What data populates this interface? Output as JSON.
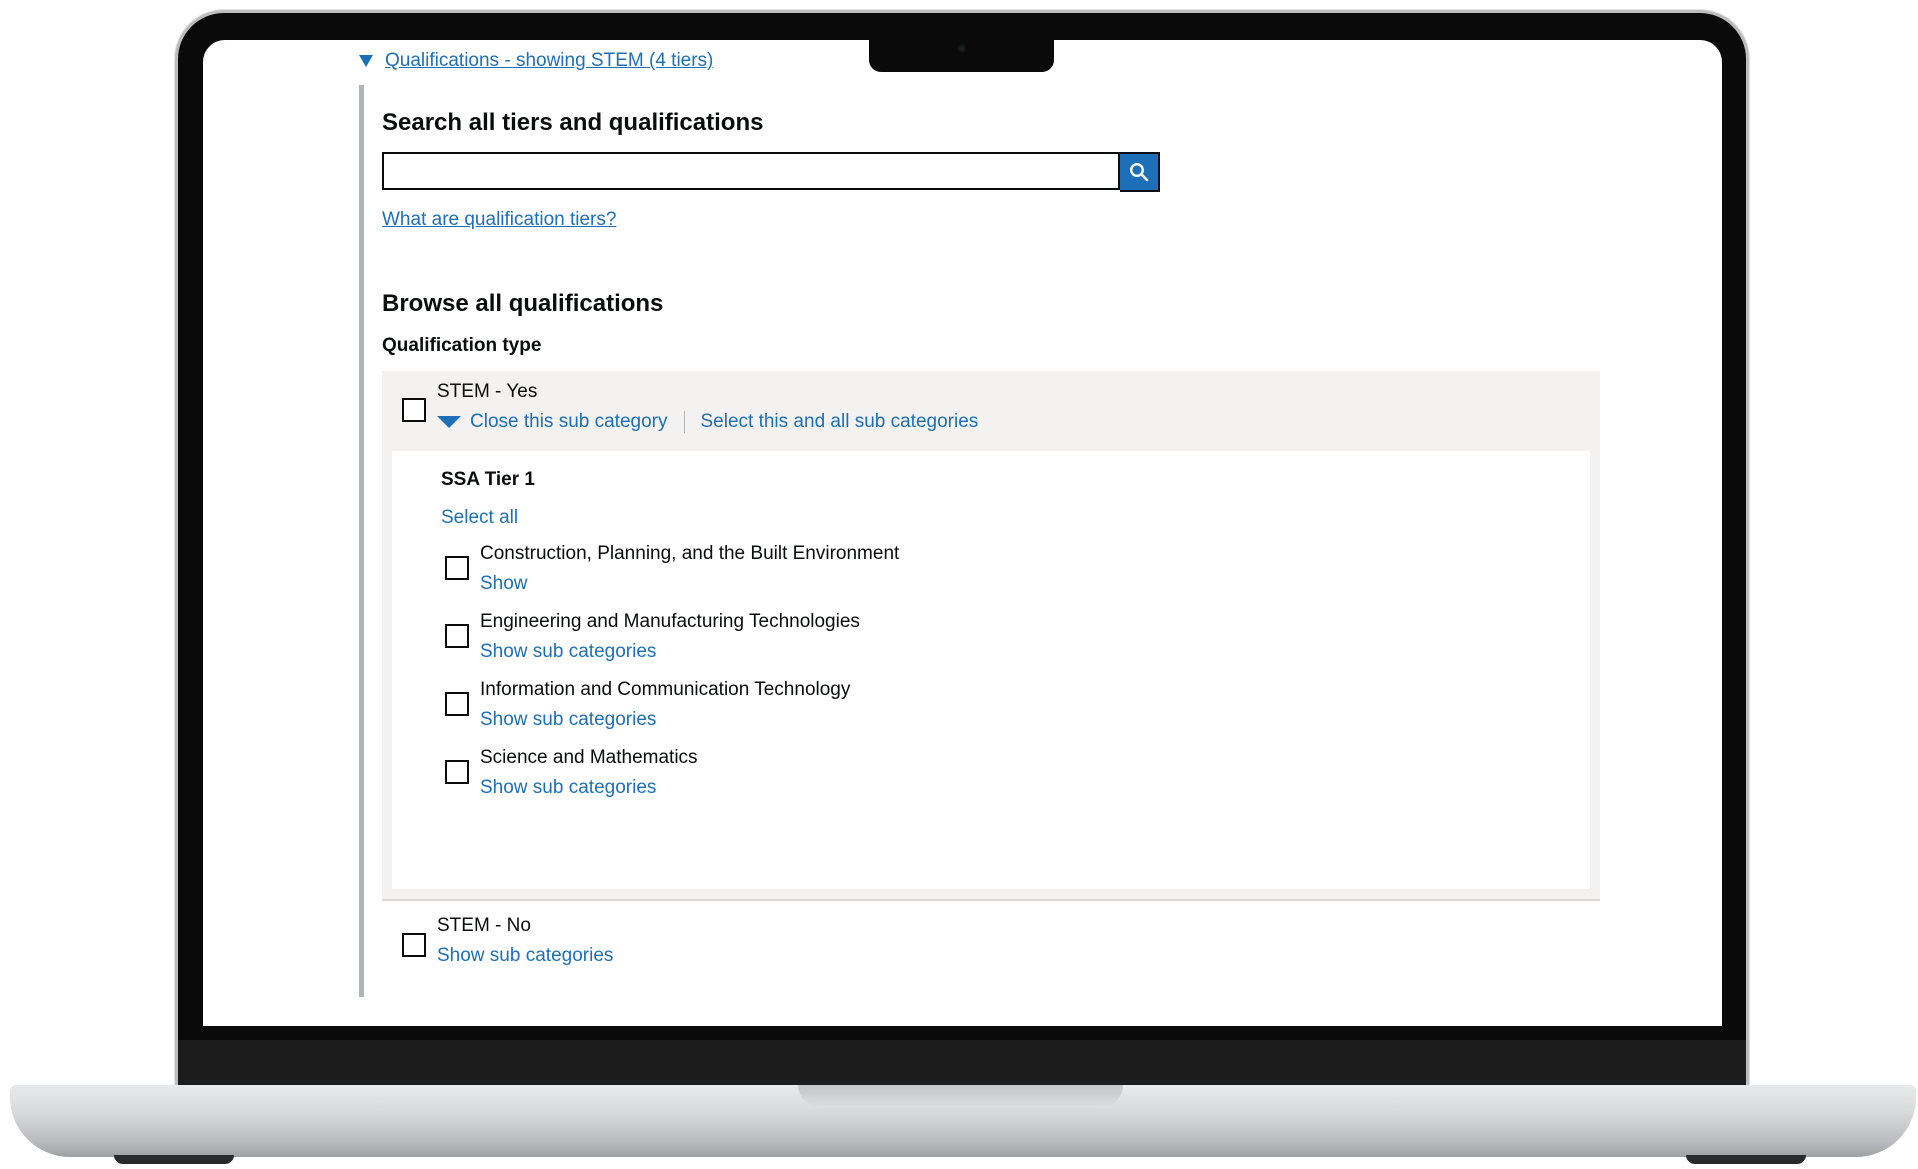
{
  "details": {
    "summary": "Qualifications - showing STEM (4 tiers)"
  },
  "search": {
    "title": "Search all tiers and qualifications",
    "value": "",
    "placeholder": "",
    "button_icon": "search-icon"
  },
  "tiers_link": "What are qualification tiers?",
  "browse": {
    "title": "Browse all qualifications",
    "qualification_type_label": "Qualification type"
  },
  "categories": [
    {
      "label": "STEM - Yes",
      "checked": false,
      "expanded": true,
      "close_label": "Close this sub category",
      "select_all_sub_label": "Select this and all sub categories",
      "tier": {
        "title": "SSA Tier 1",
        "select_all": "Select all",
        "items": [
          {
            "label": "Construction, Planning, and the Built Environment",
            "action": "Show",
            "checked": false
          },
          {
            "label": "Engineering and Manufacturing Technologies",
            "action": "Show sub categories",
            "checked": false
          },
          {
            "label": "Information and Communication Technology",
            "action": "Show sub categories",
            "checked": false
          },
          {
            "label": "Science and Mathematics",
            "action": "Show sub categories",
            "checked": false
          }
        ]
      }
    },
    {
      "label": "STEM - No",
      "checked": false,
      "expanded": false,
      "action": "Show sub categories"
    }
  ],
  "colors": {
    "link": "#1d70b8",
    "text": "#0b0c0c",
    "panel_bg": "#f3f2f1",
    "border": "#b1b4b6"
  }
}
